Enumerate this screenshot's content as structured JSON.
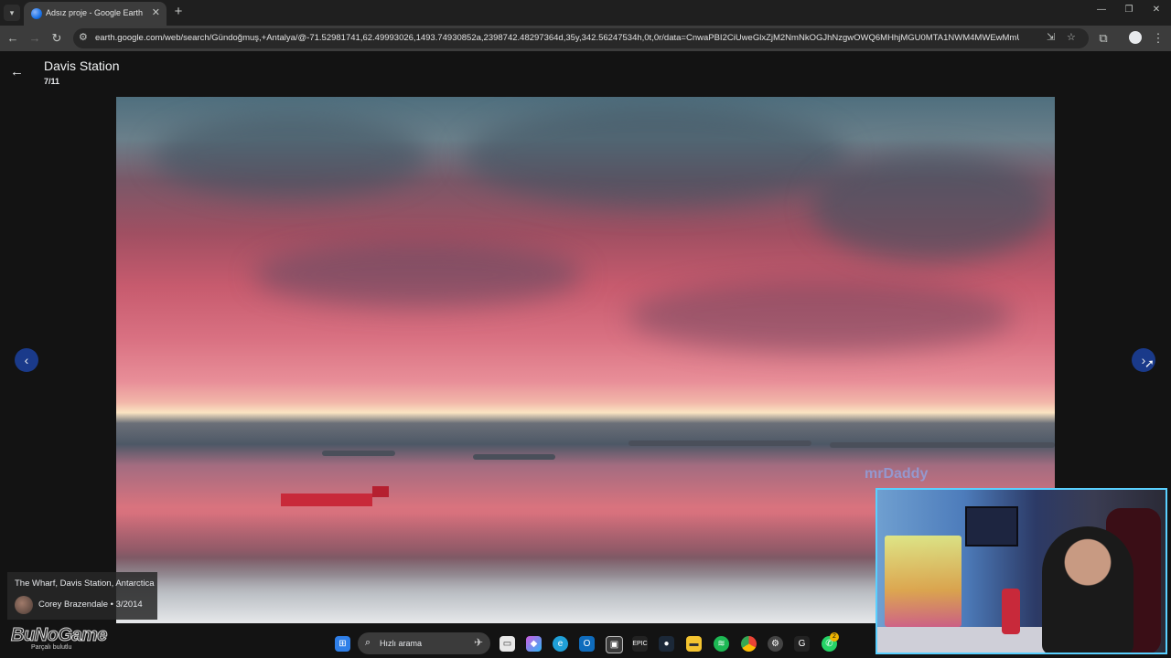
{
  "browser": {
    "tab_title": "Adsız proje - Google Earth",
    "url": "earth.google.com/web/search/Gündoğmuş,+Antalya/@-71.52981741,62.49993026,1493.74930852a,2398742.48297364d,35y,342.56247534h,0t,0r/data=CnwaPBI2CiUweGlxZjM2NmNkOGJhNzgwOWQ6MHhjMGU0MTA1NWM4MWEwMmUwKg1EYXZ...",
    "icons": [
      "tab-list-icon",
      "globe-favicon",
      "close-icon",
      "plus-icon",
      "minimize-icon",
      "restore-icon",
      "close-icon",
      "back-icon",
      "forward-icon",
      "reload-icon",
      "tune-icon",
      "install-icon",
      "star-icon",
      "extensions-icon",
      "profile-icon",
      "more-icon"
    ]
  },
  "viewer": {
    "title": "Davis Station",
    "counter": "7/11",
    "caption_place": "The Wharf, Davis Station, Antarctica",
    "caption_author": "Corey Brazendale • 3/2014",
    "overlay_text": "mrDaddy"
  },
  "taskbar": {
    "search_placeholder": "Hızlı arama",
    "brand": "BuNoGame",
    "brand_sub": "Parçalı bulutlu",
    "whatsapp_badge": "2"
  },
  "colors": {
    "page_bg": "#131313",
    "arrow_button": "#1a3a8a",
    "webcam_border": "#5ad0ff",
    "brand_red": "#d9262e"
  }
}
